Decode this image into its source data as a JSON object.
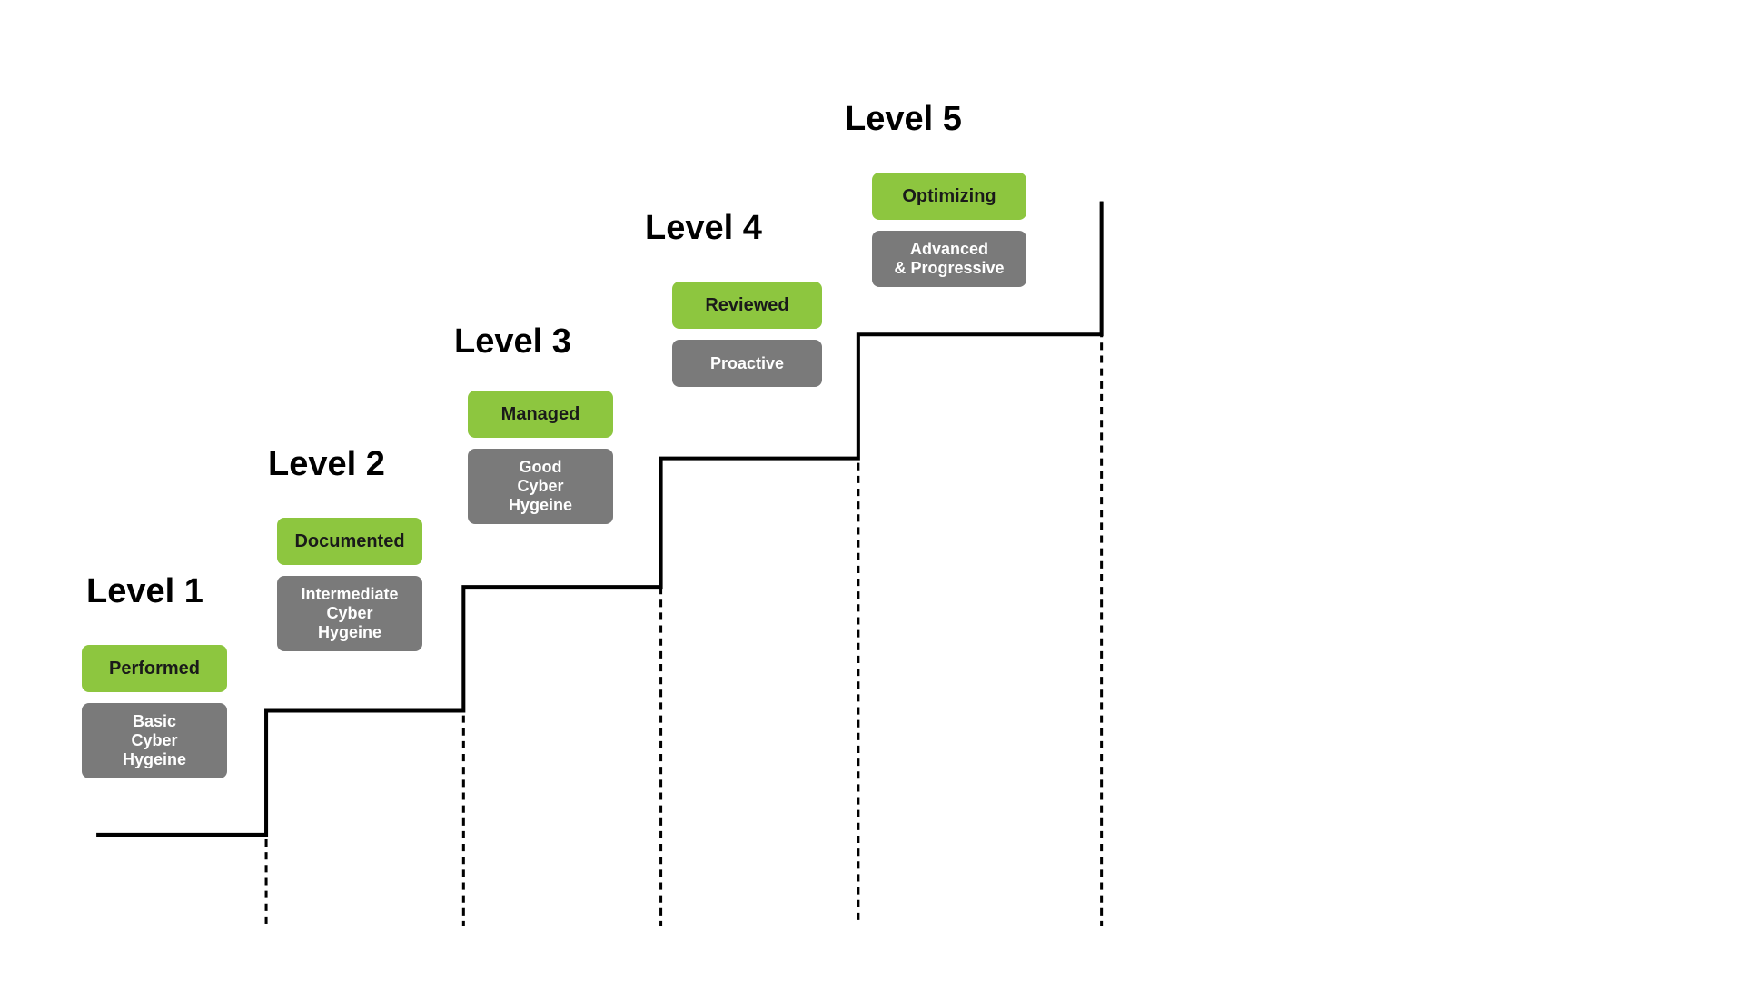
{
  "levels": [
    {
      "id": "level1",
      "label": "Level 1",
      "green_badge": "Performed",
      "gray_badge": "Basic\nCyber Hygeine"
    },
    {
      "id": "level2",
      "label": "Level 2",
      "green_badge": "Documented",
      "gray_badge": "Intermediate\nCyber Hygeine"
    },
    {
      "id": "level3",
      "label": "Level 3",
      "green_badge": "Managed",
      "gray_badge": "Good\nCyber Hygeine"
    },
    {
      "id": "level4",
      "label": "Level 4",
      "green_badge": "Reviewed",
      "gray_badge": "Proactive"
    },
    {
      "id": "level5",
      "label": "Level 5",
      "green_badge": "Optimizing",
      "gray_badge": "Advanced\n& Progressive"
    }
  ],
  "staircase": {
    "description": "5-step staircase diagram showing cybersecurity maturity levels"
  }
}
